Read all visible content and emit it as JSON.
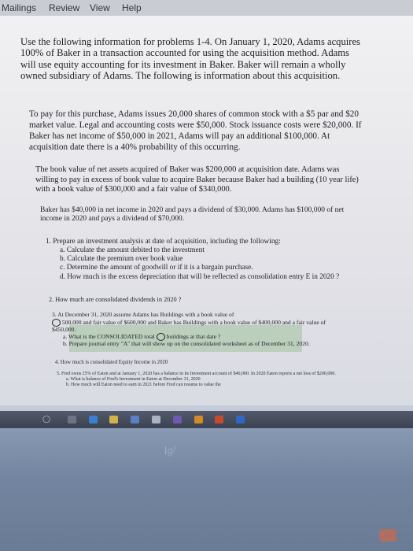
{
  "menu": [
    "Mailings",
    "Review",
    "View",
    "Help"
  ],
  "intro": "Use the following information for problems 1-4. On January 1, 2020, Adams acquires 100% of Baker in a transaction accounted for using the acquisition method. Adams will use equity accounting for its investment in Baker. Baker will remain a wholly owned subsidiary of Adams. The following is information about this acquisition.",
  "purchase": "To pay for this purchase, Adams issues 20,000 shares of common stock with a $5 par and $20 market value. Legal and accounting costs were $50,000. Stock issuance costs were $20,000. If Baker has net income of $50,000 in 2021, Adams will pay an additional $100,000. At acquisition date there is a 40% probability of this occurring.",
  "book_value": "The book value of net assets acquired of Baker was $200,000 at acquisition date. Adams was willing to pay in excess of book value to acquire Baker because Baker had a building (10 year life) with a book value of $300,000 and a fair value of $340,000.",
  "net_income": "Baker has $40,000 in net income in 2020 and pays a dividend of $30,000. Adams has $100,000 of net income in 2020 and pays a dividend of $70,000.",
  "q1": {
    "stem": "1.  Prepare an investment analysis at date of acquisition, including the following:",
    "a": "a.  Calculate the amount debited to the investment",
    "b": "b.  Calculate the premium over book value",
    "c": "c.  Determine the amount of goodwill or if it is a bargain purchase.",
    "d": "d.  How much is the excess depreciation that will be reflected as consolidation entry E in 2020 ?"
  },
  "q2": "2.  How much are consolidated dividends in 2020 ?",
  "q3": {
    "stem_a": "3.  At December 31, 2020 assume Adams has Buildings with a book value of",
    "stem_b": "500,000 and fair value of $600,000 and Baker has Buildings with a book value of $400,000 and a fair value of $450,000.",
    "a_pre": "a.  What is the CONSOLIDATED total",
    "a_post": "buildings at that date ?",
    "b": "b.  Prepare journal entry \"A\" that will show up on the consolidated worksheet as of December 31, 2020."
  },
  "q4": "4.  How much is consolidated Equity Income in 2020",
  "q5": {
    "stem": "5.  Fred owns 25% of Eaton and at January 1, 2020 has a balance in its Investment account of $40,000. In 2020 Eaton reports a net loss of $200,000.",
    "a": "a.  What is balance of Fred's Investment in Eaton at December 31, 2020",
    "b": "b.  How much will Eaton need to earn in 2021 before Fred can resume to value the"
  },
  "reflection": "lg/"
}
